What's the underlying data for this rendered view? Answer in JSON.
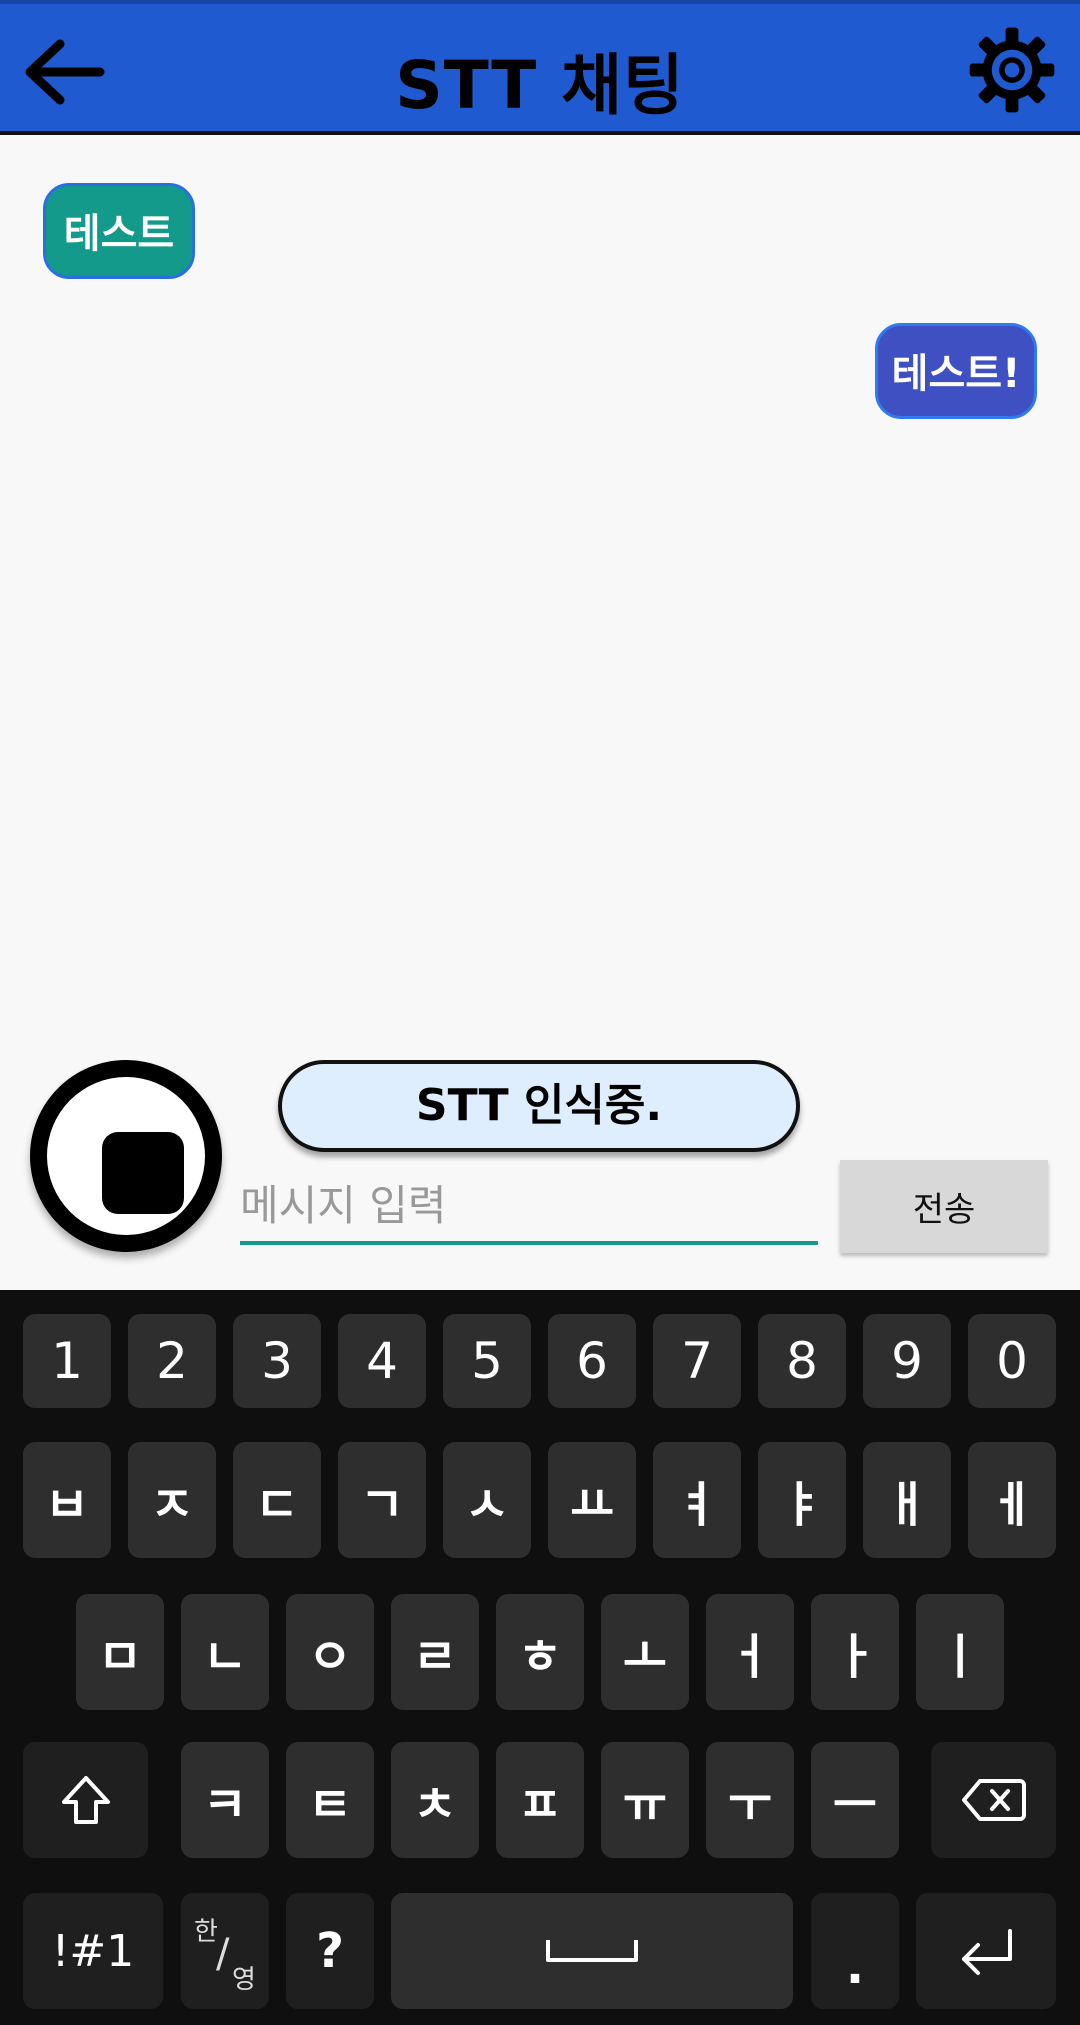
{
  "header": {
    "title": "STT 채팅",
    "back_icon": "arrow-left-icon",
    "settings_icon": "gear-icon",
    "color": "#1f5ad1"
  },
  "chat": {
    "messages": [
      {
        "side": "left",
        "text": "테스트",
        "color": "#139a8a"
      },
      {
        "side": "right",
        "text": "테스트!",
        "color": "#3f51c2"
      }
    ],
    "stt_status": "STT 인식중."
  },
  "input": {
    "placeholder": "메시지 입력",
    "value": "",
    "send_label": "전송",
    "stop_icon": "stop-icon"
  },
  "keyboard": {
    "row1": [
      "1",
      "2",
      "3",
      "4",
      "5",
      "6",
      "7",
      "8",
      "9",
      "0"
    ],
    "row2": [
      "ㅂ",
      "ㅈ",
      "ㄷ",
      "ㄱ",
      "ㅅ",
      "ㅛ",
      "ㅕ",
      "ㅑ",
      "ㅐ",
      "ㅔ"
    ],
    "row3": [
      "ㅁ",
      "ㄴ",
      "ㅇ",
      "ㄹ",
      "ㅎ",
      "ㅗ",
      "ㅓ",
      "ㅏ",
      "ㅣ"
    ],
    "row4": [
      "ㅋ",
      "ㅌ",
      "ㅊ",
      "ㅍ",
      "ㅠ",
      "ㅜ",
      "ㅡ"
    ],
    "symbols_label": "!#1",
    "lang_label_top": "한",
    "lang_label_bottom": "영",
    "question_label": "?",
    "period_label": ".",
    "shift_icon": "shift-icon",
    "backspace_icon": "backspace-icon",
    "space_icon": "space-icon",
    "enter_icon": "enter-icon"
  }
}
